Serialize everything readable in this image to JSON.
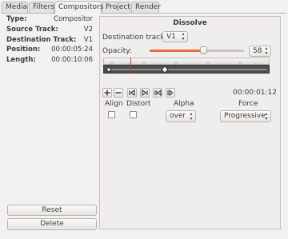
{
  "tabs": [
    {
      "label": "Media",
      "active": false
    },
    {
      "label": "Filters",
      "active": false
    },
    {
      "label": "Compositors",
      "active": true
    },
    {
      "label": "Project",
      "active": false
    },
    {
      "label": "Render",
      "active": false
    }
  ],
  "info": [
    {
      "key": "Type:",
      "value": "Compositor"
    },
    {
      "key": "Source Track:",
      "value": "V2"
    },
    {
      "key": "Destination Track:",
      "value": "V1"
    },
    {
      "key": "Position:",
      "value": "00:00:05:24"
    },
    {
      "key": "Length:",
      "value": "00:00:10:06"
    }
  ],
  "buttons": {
    "reset": "Reset",
    "delete": "Delete"
  },
  "dissolve": {
    "title": "Dissolve",
    "destination_label": "Destination track:",
    "destination_value": "V1",
    "opacity_label": "Opacity:",
    "opacity_value": "58",
    "opacity_fraction": 0.58,
    "timecode": "00:00:01:12",
    "align_label": "Align",
    "distort_label": "Distort",
    "alpha_label": "Alpha",
    "alpha_value": "over",
    "force_label": "Force",
    "force_value": "Progressive"
  },
  "icons": [
    "plus-icon",
    "minus-icon",
    "skip-start-icon",
    "skip-end-icon",
    "previous-keyframe-icon",
    "next-keyframe-icon"
  ],
  "colors": {
    "slider_fill": "#e8693a",
    "playhead": "#d23b3b"
  }
}
